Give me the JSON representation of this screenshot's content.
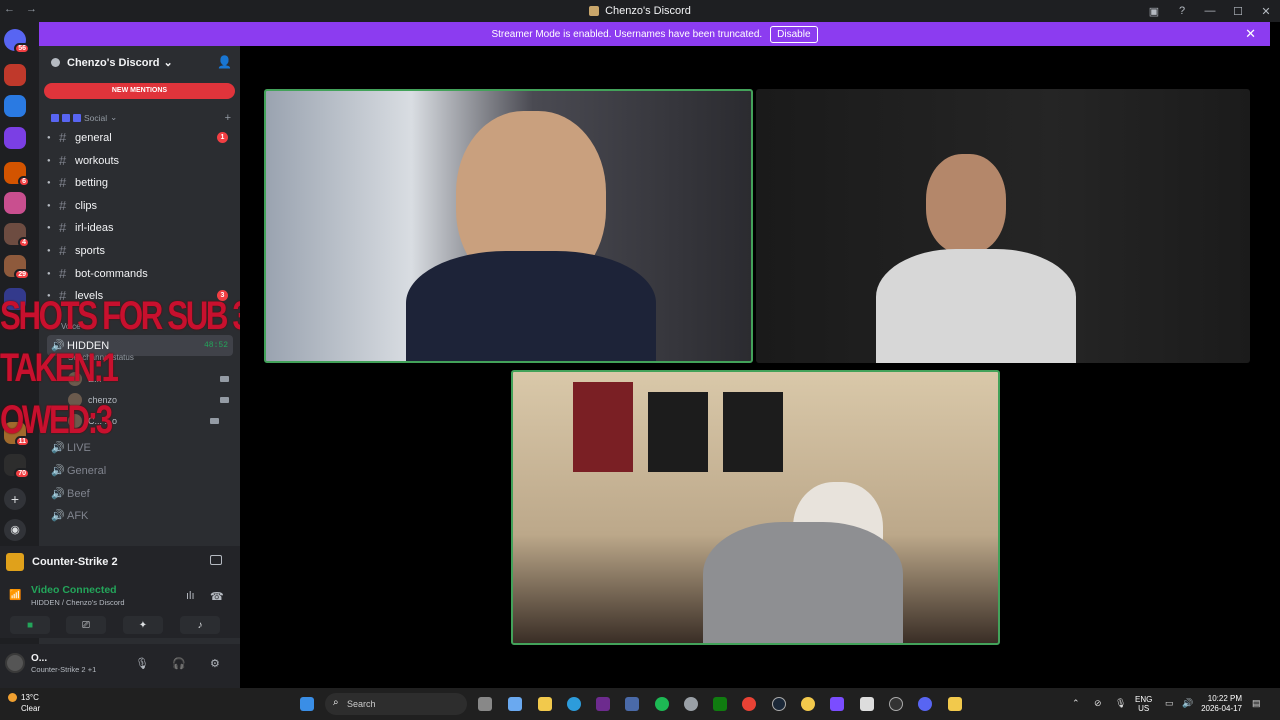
{
  "window": {
    "title": "Chenzo's Discord",
    "nav": "← →",
    "controls": [
      "▣",
      "?",
      "—",
      "☐",
      "✕"
    ]
  },
  "banner": {
    "text": "Streamer Mode is enabled. Usernames have been truncated.",
    "button": "Disable",
    "close": "✕"
  },
  "rail": {
    "badges": [
      "56",
      "6",
      "4",
      "29",
      "11",
      "70"
    ]
  },
  "server": {
    "name": "Chenzo's Discord",
    "chevron": "⌄",
    "new_mentions": "NEW MENTIONS"
  },
  "category": {
    "name": "Social",
    "chevron": "⌄",
    "plus": "+"
  },
  "channels": [
    {
      "name": "general",
      "badge": "1"
    },
    {
      "name": "workouts",
      "badge": ""
    },
    {
      "name": "betting",
      "badge": ""
    },
    {
      "name": "clips",
      "badge": ""
    },
    {
      "name": "irl-ideas",
      "badge": ""
    },
    {
      "name": "sports",
      "badge": ""
    },
    {
      "name": "bot-commands",
      "badge": ""
    },
    {
      "name": "levels",
      "badge": "3"
    }
  ],
  "voice_category": "Voice",
  "voice_channels": [
    {
      "name": "HIDDEN",
      "time": "48:52",
      "status": "Set channel status"
    },
    {
      "name": "LIVE"
    },
    {
      "name": "General"
    },
    {
      "name": "Beef"
    },
    {
      "name": "AFK"
    }
  ],
  "voice_users": [
    "E...",
    "chenzo",
    "C... ...o"
  ],
  "overlay": {
    "line1": "SHOTS FOR SUB 3/",
    "line2": "TAKEN:1",
    "line3": "OWED:3"
  },
  "activity": {
    "game": "Counter-Strike 2"
  },
  "voice_status": {
    "title": "Video Connected",
    "location": "HIDDEN / Chenzo's Discord"
  },
  "user": {
    "name": "O...",
    "status": "Counter-Strike 2 +1"
  },
  "taskbar": {
    "weather_temp": "13°C",
    "weather_desc": "Clear",
    "search_placeholder": "Search",
    "lang": "ENG",
    "region": "US",
    "time": "10:22 PM",
    "date": "2026-04-17"
  },
  "colors": {
    "accent": "#5865f2",
    "speaking": "#43a25a",
    "banner": "#8c3cf0",
    "alert": "#f23f43",
    "overlay": "#c8102e"
  }
}
